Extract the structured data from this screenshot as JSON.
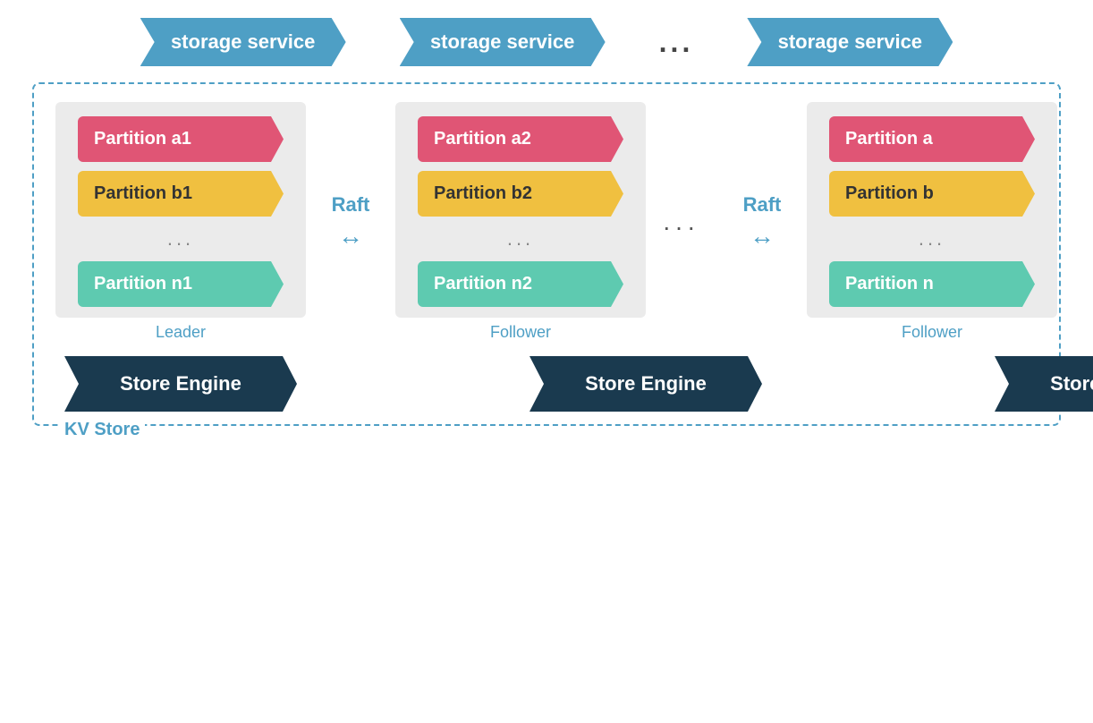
{
  "top": {
    "storage1": "storage service",
    "storage2": "storage service",
    "storage3": "storage service",
    "dots": "..."
  },
  "nodes": [
    {
      "id": "node1",
      "partitions": [
        {
          "label": "Partition a1",
          "color": "pink"
        },
        {
          "label": "Partition b1",
          "color": "yellow"
        },
        {
          "label": "Partition n1",
          "color": "teal"
        }
      ],
      "role": "Leader"
    },
    {
      "id": "node2",
      "partitions": [
        {
          "label": "Partition a2",
          "color": "pink"
        },
        {
          "label": "Partition b2",
          "color": "yellow"
        },
        {
          "label": "Partition n2",
          "color": "teal"
        }
      ],
      "role": "Follower"
    },
    {
      "id": "node3",
      "partitions": [
        {
          "label": "Partition a",
          "color": "pink"
        },
        {
          "label": "Partition b",
          "color": "yellow"
        },
        {
          "label": "Partition n",
          "color": "teal"
        }
      ],
      "role": "Follower"
    }
  ],
  "raft": {
    "label": "Raft",
    "arrow": "↔"
  },
  "betweenDots": "...",
  "nodeDots": "...",
  "storeEngines": [
    "Store Engine",
    "Store Engine",
    "Store Engine"
  ],
  "kvLabel": "KV Store"
}
